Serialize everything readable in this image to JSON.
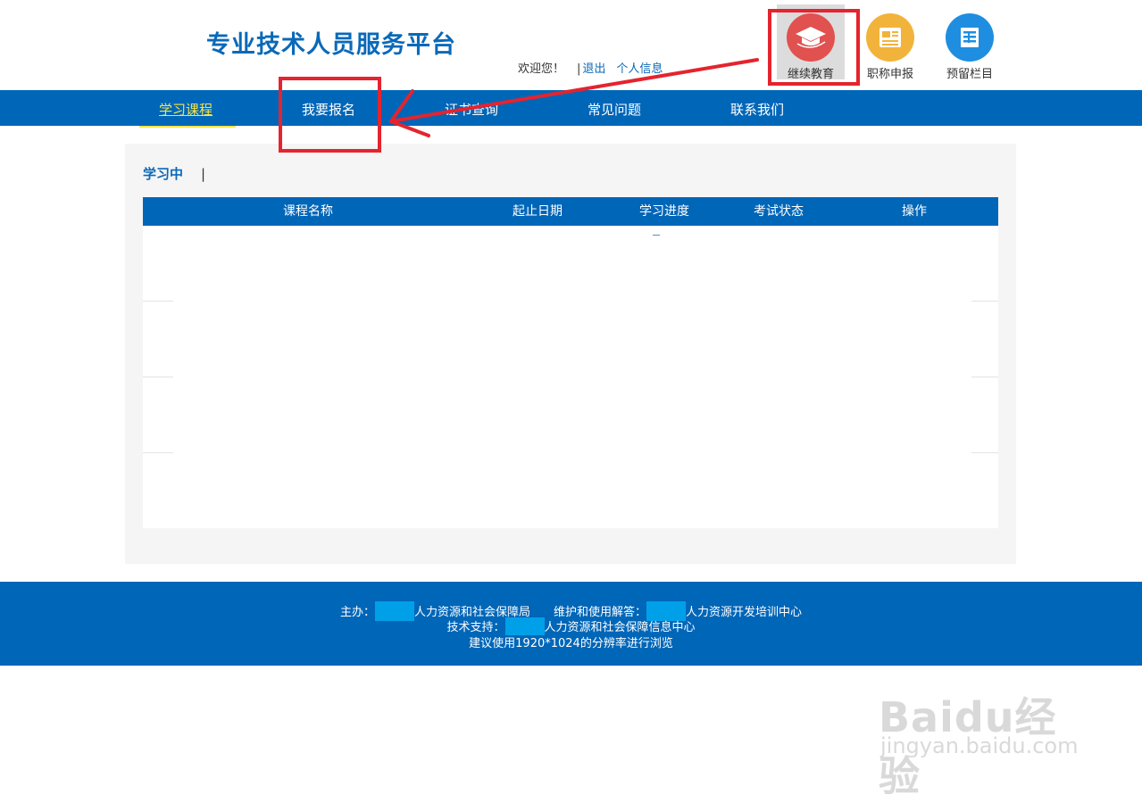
{
  "header": {
    "site_title": "专业技术人员服务平台",
    "welcome": "欢迎您！",
    "separator": "|",
    "logout": "退出",
    "profile": "个人信息"
  },
  "top_nav": [
    {
      "label": "继续教育",
      "icon": "graduation-cap-icon",
      "color": "#e05150",
      "active": true
    },
    {
      "label": "职称申报",
      "icon": "document-icon",
      "color": "#f2b33b"
    },
    {
      "label": "预留栏目",
      "icon": "newspaper-icon",
      "color": "#1f8ee0"
    }
  ],
  "main_nav": [
    {
      "label": "学习课程",
      "active": true
    },
    {
      "label": "我要报名"
    },
    {
      "label": "证书查询"
    },
    {
      "label": "常见问题"
    },
    {
      "label": "联系我们"
    }
  ],
  "sub_tabs": {
    "active": "学习中",
    "separator": "|"
  },
  "table": {
    "headers": [
      "课程名称",
      "起止日期",
      "学习进度",
      "考试状态",
      "操作"
    ],
    "rows": []
  },
  "footer": {
    "host_label": "主办：",
    "host_org": "人力资源和社会保障局",
    "support_label": "维护和使用解答：",
    "support_org": "人力资源开发培训中心",
    "tech_label": "技术支持：",
    "tech_org": "人力资源和社会保障信息中心",
    "resolution_note": "建议使用1920*1024的分辨率进行浏览"
  },
  "watermark": {
    "logo": "Baidu经验",
    "url": "jingyan.baidu.com"
  },
  "colors": {
    "brand_blue": "#0066b8",
    "active_nav": "#f4e54a",
    "annotation_red": "#e4242e",
    "redaction": "#00a0e9"
  }
}
